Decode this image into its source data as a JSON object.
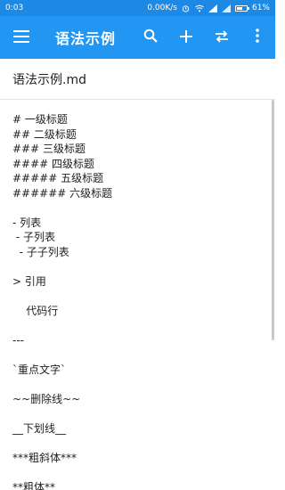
{
  "status_bar": {
    "time": "0:03",
    "net_speed": "0.00K/s",
    "battery": "61%",
    "battery_level": 0.61
  },
  "app_bar": {
    "title": "语法示例",
    "icons": [
      "menu-icon",
      "search-icon",
      "add-icon",
      "swap-icon",
      "more-vert-icon"
    ]
  },
  "file": {
    "name": "语法示例.md"
  },
  "editor": {
    "h1": "# 一级标题",
    "h2": "## 二级标题",
    "h3": "### 三级标题",
    "h4": "#### 四级标题",
    "h5": "##### 五级标题",
    "h6": "###### 六级标题",
    "list1": "- 列表",
    "list2": " - 子列表",
    "list3": "  - 子子列表",
    "quote": "> 引用",
    "code": "    代码行",
    "hr": "---",
    "inline_code": "`重点文字`",
    "strike": "~~删除线~~",
    "underline": "__下划线__",
    "bold_italic": "***粗斜体***",
    "bold": "**粗体**"
  },
  "colors": {
    "app_bar": "#2196f3",
    "status_bar": "#1e88e5"
  }
}
